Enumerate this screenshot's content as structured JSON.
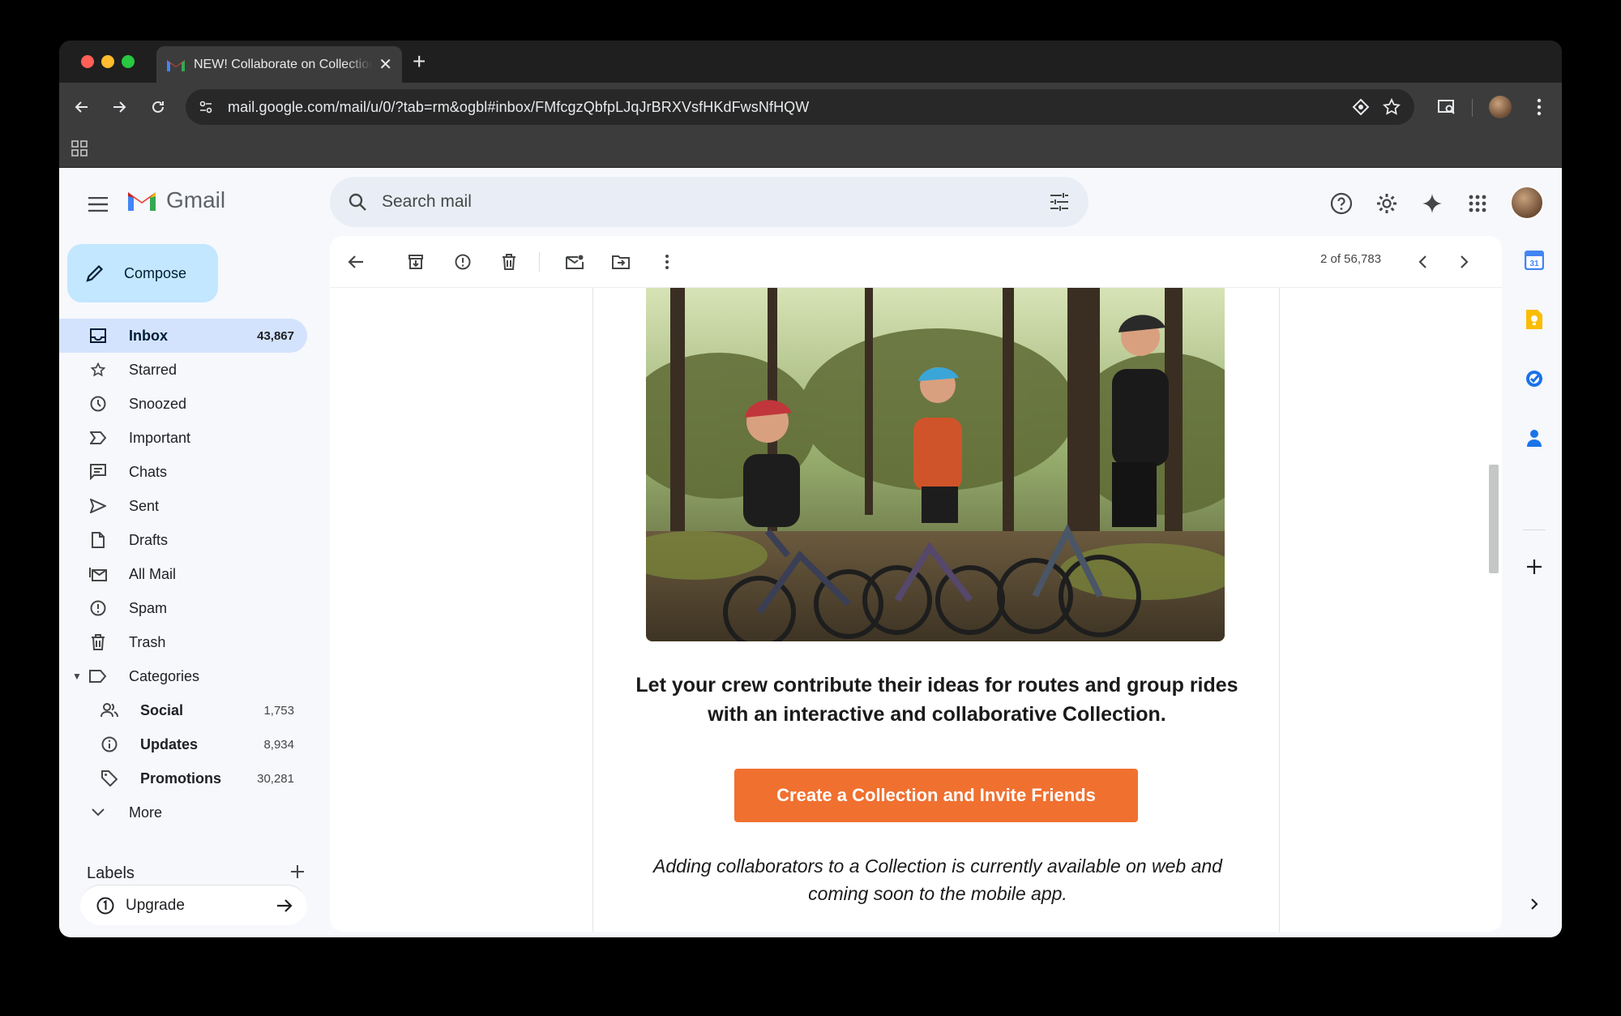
{
  "browser": {
    "tab_title": "NEW! Collaborate on Collections",
    "url": "mail.google.com/mail/u/0/?tab=rm&ogbl#inbox/FMfcgzQbfpLJqJrBRXVsfHKdFwsNfHQW"
  },
  "gmail": {
    "logo_text": "Gmail",
    "search_placeholder": "Search mail",
    "compose_label": "Compose",
    "nav": [
      {
        "label": "Inbox",
        "count": "43,867"
      },
      {
        "label": "Starred"
      },
      {
        "label": "Snoozed"
      },
      {
        "label": "Important"
      },
      {
        "label": "Chats"
      },
      {
        "label": "Sent"
      },
      {
        "label": "Drafts"
      },
      {
        "label": "All Mail"
      },
      {
        "label": "Spam"
      },
      {
        "label": "Trash"
      },
      {
        "label": "Categories"
      }
    ],
    "categories": [
      {
        "label": "Social",
        "count": "1,753"
      },
      {
        "label": "Updates",
        "count": "8,934"
      },
      {
        "label": "Promotions",
        "count": "30,281"
      }
    ],
    "more_label": "More",
    "labels_title": "Labels",
    "upgrade_label": "Upgrade",
    "pager": "2 of 56,783"
  },
  "email": {
    "headline": "Let your crew contribute their ideas for routes and group rides with an interactive and collaborative Collection.",
    "cta": "Create a Collection and Invite Friends",
    "note": "Adding collaborators to a Collection is currently available on web and coming soon to the mobile app."
  },
  "colors": {
    "accent_cta": "#f07030",
    "compose_bg": "#c2e7ff",
    "active_nav_bg": "#d3e3fd"
  }
}
